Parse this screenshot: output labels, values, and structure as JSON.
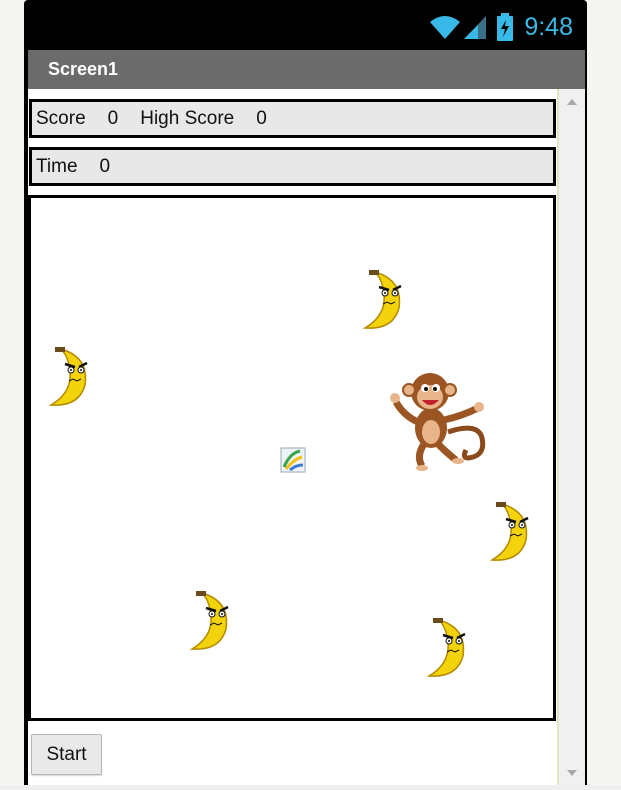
{
  "status_bar": {
    "time": "9:48",
    "icons": [
      "wifi-icon",
      "signal-icon",
      "battery-icon"
    ],
    "accent_color": "#39b9e8"
  },
  "title_bar": {
    "title": "Screen1",
    "background": "#6b6b6b"
  },
  "score_row": {
    "score_label": "Score",
    "score_value": "0",
    "high_score_label": "High Score",
    "high_score_value": "0"
  },
  "time_row": {
    "time_label": "Time",
    "time_value": "0"
  },
  "canvas": {
    "sprites": [
      "banana-sprite",
      "banana-sprite",
      "banana-sprite",
      "banana-sprite",
      "banana-sprite",
      "monkey-sprite",
      "image-placeholder-icon"
    ]
  },
  "start_button": {
    "label": "Start"
  }
}
